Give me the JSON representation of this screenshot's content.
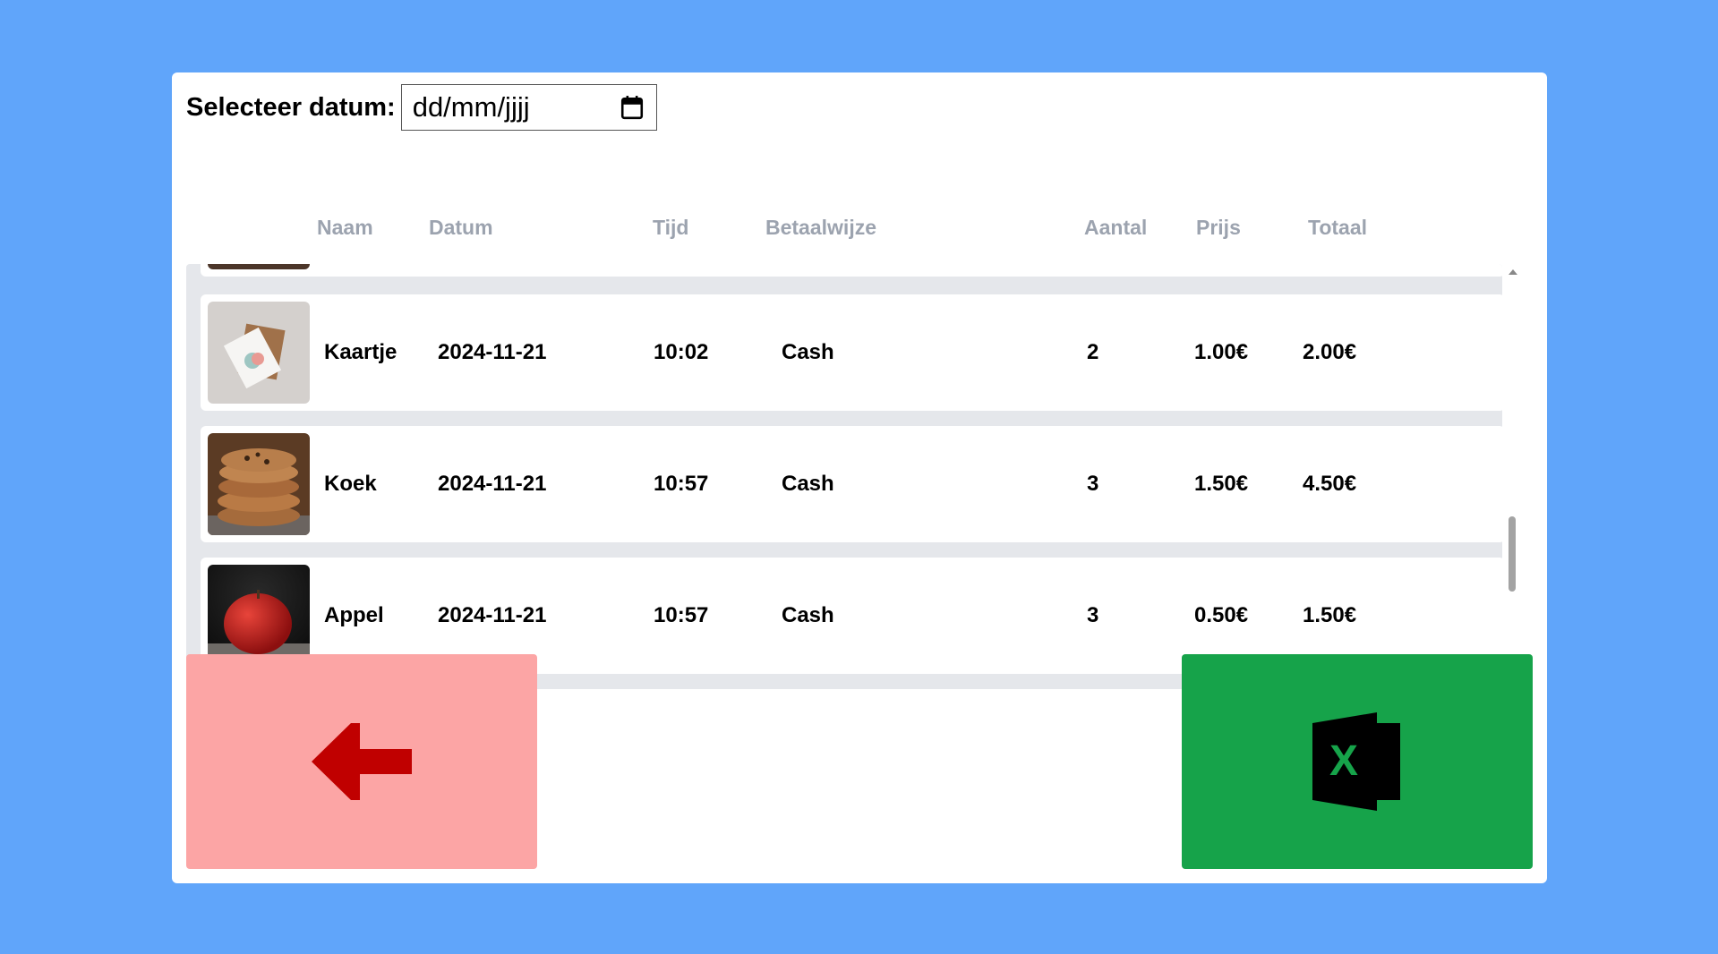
{
  "date_picker": {
    "label": "Selecteer datum:",
    "placeholder": "dd/mm/jjjj",
    "icon": "calendar-icon"
  },
  "columns": {
    "naam": "Naam",
    "datum": "Datum",
    "tijd": "Tijd",
    "betaalwijze": "Betaalwijze",
    "aantal": "Aantal",
    "prijs": "Prijs",
    "totaal": "Totaal"
  },
  "rows": [
    {
      "naam": "Kaartje",
      "datum": "2024-11-21",
      "tijd": "10:02",
      "betaalwijze": "Cash",
      "aantal": "2",
      "prijs": "1.00€",
      "totaal": "2.00€",
      "image": "card-photo"
    },
    {
      "naam": "Koek",
      "datum": "2024-11-21",
      "tijd": "10:57",
      "betaalwijze": "Cash",
      "aantal": "3",
      "prijs": "1.50€",
      "totaal": "4.50€",
      "image": "cookie-photo"
    },
    {
      "naam": "Appel",
      "datum": "2024-11-21",
      "tijd": "10:57",
      "betaalwijze": "Cash",
      "aantal": "3",
      "prijs": "0.50€",
      "totaal": "1.50€",
      "image": "apple-photo"
    }
  ],
  "buttons": {
    "back": {
      "icon": "arrow-left-icon",
      "color": "#fca5a5",
      "icon_color": "#c00000"
    },
    "export": {
      "icon": "excel-icon",
      "color": "#16a34a"
    }
  },
  "colors": {
    "background": "#60a5fa",
    "header_text": "#9ca3af",
    "list_bg": "#e5e7eb"
  }
}
